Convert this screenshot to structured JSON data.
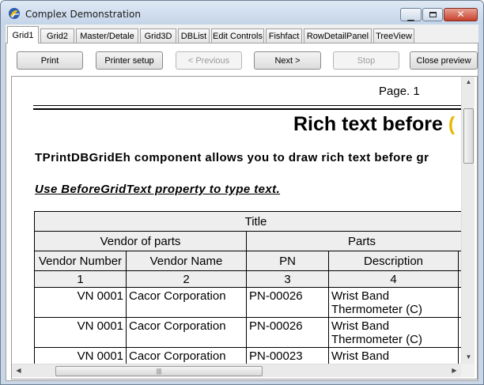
{
  "window": {
    "title": "Complex Demonstration"
  },
  "tabs": [
    {
      "label": "Grid1",
      "active": true
    },
    {
      "label": "Grid2"
    },
    {
      "label": "Master/Detale"
    },
    {
      "label": "Grid3D"
    },
    {
      "label": "DBList"
    },
    {
      "label": "Edit Controls"
    },
    {
      "label": "Fishfact"
    },
    {
      "label": "RowDetailPanel"
    },
    {
      "label": "TreeView"
    }
  ],
  "toolbar": {
    "print": "Print",
    "printer_setup": "Printer setup",
    "previous": "< Previous",
    "next": "Next >",
    "stop": "Stop",
    "close_preview": "Close preview"
  },
  "preview": {
    "page_label": "Page. 1",
    "rich_title": "Rich text before",
    "rich_title_tail": "(",
    "rich_line2": "TPrintDBGridEh component allows you to draw rich text before gr",
    "rich_line3": "Use BeforeGridText property to type text.",
    "table": {
      "title": "Title",
      "group_vendor": "Vendor of parts",
      "group_parts": "Parts",
      "columns": [
        "Vendor Number",
        "Vendor Name",
        "PN",
        "Description"
      ],
      "column_numbers": [
        "1",
        "2",
        "3",
        "4"
      ],
      "rows": [
        [
          "VN 0001",
          "Cacor Corporation",
          "PN-00026",
          "Wrist Band Thermometer (C)"
        ],
        [
          "VN 0001",
          "Cacor Corporation",
          "PN-00026",
          "Wrist Band Thermometer (C)"
        ],
        [
          "VN 0001",
          "Cacor Corporation",
          "PN-00023",
          "Wrist Band"
        ]
      ]
    }
  },
  "colors": {
    "accent_yellow": "#e8b800",
    "header_gray": "#eeeeee"
  }
}
